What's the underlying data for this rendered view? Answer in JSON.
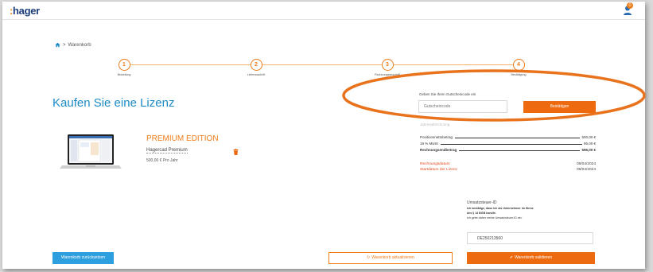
{
  "header": {
    "logo_text": "hager",
    "logo_colon": ":",
    "cart_badge_count": "0"
  },
  "breadcrumb": {
    "current": "Warenkorb",
    "separator": ">"
  },
  "steps": [
    {
      "number": "1",
      "label": "Bestellung"
    },
    {
      "number": "2",
      "label": "Lieferanschrift"
    },
    {
      "number": "3",
      "label": "Rechnungsanschrift"
    },
    {
      "number": "4",
      "label": "Bestätigung"
    }
  ],
  "page": {
    "title": "Kaufen Sie eine Lizenz"
  },
  "voucher": {
    "label": "Geben Sie Ihren Gutscheincode ein",
    "placeholder": "Gutscheincode",
    "confirm_label": "Bestätigen"
  },
  "product": {
    "edition": "PREMIUM EDITION",
    "name": "Hagercad Premium",
    "price": "500,00 € Pro Jahr"
  },
  "summary": {
    "title": "Jahresabrechnung",
    "rows": [
      {
        "label": "Positionsnettobetrag",
        "value": "500,00 €"
      },
      {
        "label": "19 % MwSt",
        "value": "95,00 €"
      },
      {
        "label": "Rechnungsendbetrag",
        "value": "595,00 €"
      }
    ],
    "billing_date_label": "Rechnungsdatum",
    "billing_date": "09/04/2024",
    "license_start_label": "Startdatum der Lizenz",
    "license_start": "09/04/2024"
  },
  "vat": {
    "title": "Umsatzsteuer-ID",
    "line1": "Ich bestätige, dass ich als Unternehmer im Sinne",
    "line2": "des § 14 BGB handle.",
    "line3": "Ich gebe daher meine Umsatzsteuer-ID ein:",
    "value": "DE250213560"
  },
  "buttons": {
    "back": "Warenkorb zurücksetzen",
    "update": "Warenkorb aktualisieren",
    "validate": "Warenkorb validieren"
  },
  "colors": {
    "brand_orange": "#ee6a0f",
    "brand_blue": "#1b8ac7",
    "logo_navy": "#1a3d7c"
  }
}
